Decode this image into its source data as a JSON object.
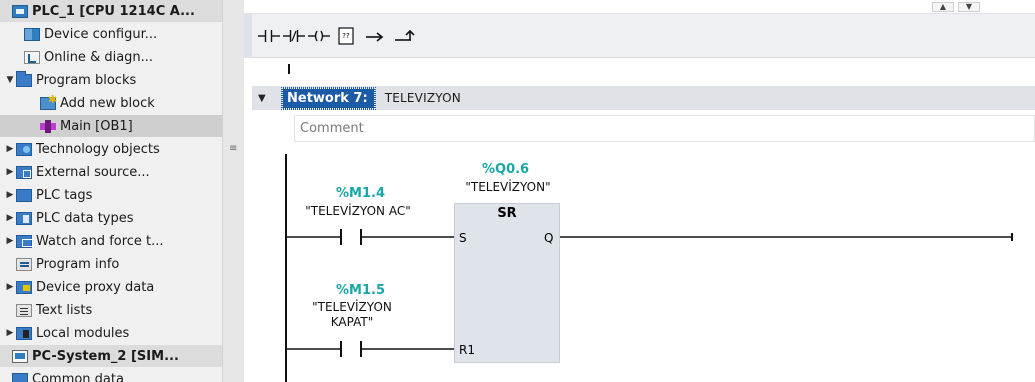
{
  "tree": {
    "items": [
      {
        "label": "PLC_1 [CPU 1214C A...",
        "icon": "cpu-icon",
        "expander": ""
      },
      {
        "label": "Device configur...",
        "icon": "device-config-icon",
        "expander": ""
      },
      {
        "label": "Online & diagn...",
        "icon": "online-diagnostics-icon",
        "expander": ""
      },
      {
        "label": "Program blocks",
        "icon": "folder-icon",
        "expander": "▼"
      },
      {
        "label": "Add new block",
        "icon": "add-block-icon",
        "expander": ""
      },
      {
        "label": "Main [OB1]",
        "icon": "ob-block-icon",
        "expander": ""
      },
      {
        "label": "Technology objects",
        "icon": "technology-objects-icon",
        "expander": "▶"
      },
      {
        "label": "External source...",
        "icon": "external-source-icon",
        "expander": "▶"
      },
      {
        "label": "PLC tags",
        "icon": "plc-tags-icon",
        "expander": "▶"
      },
      {
        "label": "PLC data types",
        "icon": "plc-data-types-icon",
        "expander": "▶"
      },
      {
        "label": "Watch and force t...",
        "icon": "watch-force-icon",
        "expander": "▶"
      },
      {
        "label": "Program info",
        "icon": "program-info-icon",
        "expander": ""
      },
      {
        "label": "Device proxy data",
        "icon": "device-proxy-icon",
        "expander": "▶"
      },
      {
        "label": "Text lists",
        "icon": "text-lists-icon",
        "expander": ""
      },
      {
        "label": "Local modules",
        "icon": "local-modules-icon",
        "expander": "▶"
      },
      {
        "label": "PC-System_2 [SIM...",
        "icon": "pc-system-icon",
        "expander": ""
      },
      {
        "label": "Common data",
        "icon": "common-data-icon",
        "expander": ""
      }
    ],
    "splitter_mark": "≡"
  },
  "toolbar": {
    "buttons": [
      {
        "name": "normally-open-contact-button",
        "icon": "no-contact-icon"
      },
      {
        "name": "normally-closed-contact-button",
        "icon": "nc-contact-icon"
      },
      {
        "name": "coil-button",
        "icon": "coil-icon"
      },
      {
        "name": "empty-box-button",
        "icon": "empty-box-icon",
        "text": "??"
      },
      {
        "name": "open-branch-button",
        "icon": "open-branch-icon"
      },
      {
        "name": "close-branch-button",
        "icon": "close-branch-icon"
      }
    ]
  },
  "network": {
    "collapse_glyph": "▼",
    "title": "Network 7:",
    "title_text": "TELEVIZYON",
    "comment_placeholder": "Comment",
    "coil_block": {
      "address": "%Q0.6",
      "symbol": "\"TELEVİZYON\"",
      "type": "SR",
      "pin_s": "S",
      "pin_q": "Q",
      "pin_r1": "R1"
    },
    "contact1": {
      "address": "%M1.4",
      "symbol": "\"TELEVİZYON AC\""
    },
    "contact2": {
      "address": "%M1.5",
      "symbol_line1": "\"TELEVİZYON",
      "symbol_line2": "KAPAT\""
    }
  },
  "colors": {
    "address": "#1aa6a6",
    "network_title_bg": "#1a5aa6",
    "block_bg": "#dfe3ea"
  }
}
